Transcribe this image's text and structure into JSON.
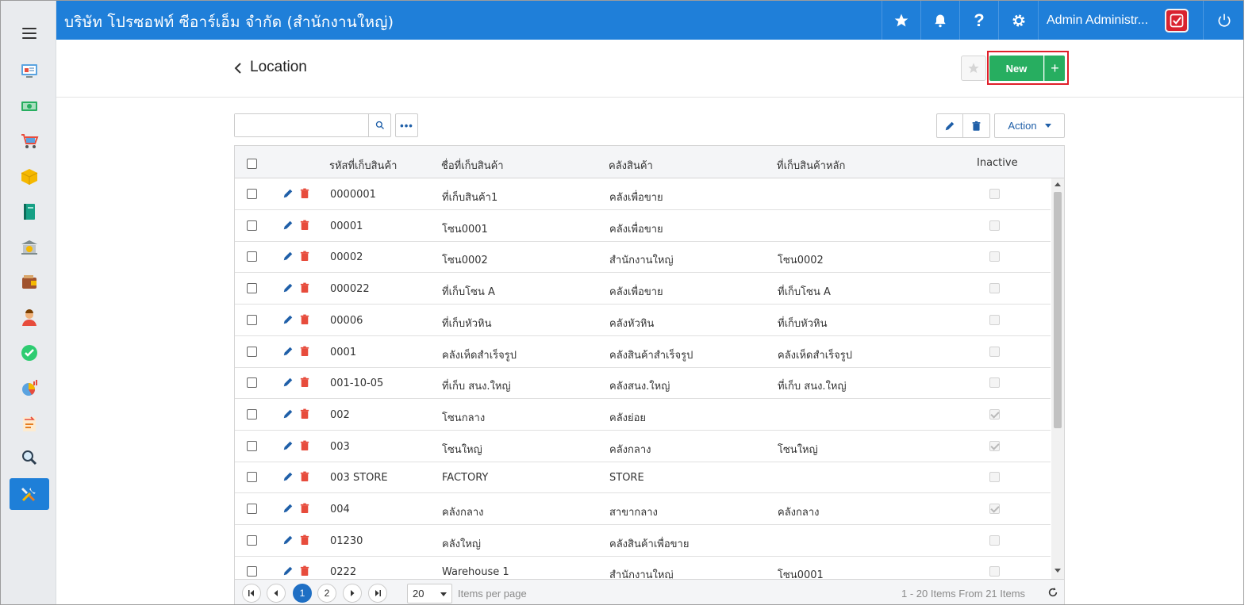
{
  "colors": {
    "topbar": "#1f7fd9",
    "new_button": "#27ae60",
    "highlight": "#e0202a",
    "link_blue": "#1f5fa8",
    "delete_red": "#e74c3c",
    "pager_active": "#1f6fc4"
  },
  "topbar": {
    "company": "บริษัท โปรซอฟท์ ซีอาร์เอ็ม จำกัด (สำนักงานใหญ่)",
    "user_name": "Admin Administr...",
    "icons": [
      "star-icon",
      "bell-icon",
      "help-icon",
      "gear-icon",
      "avatar",
      "power-icon"
    ]
  },
  "sidebar": {
    "icons": [
      "menu-icon",
      "dashboard-icon",
      "money-icon",
      "cart-icon",
      "box-icon",
      "book-icon",
      "bank-icon",
      "wallet-icon",
      "user-icon",
      "check-icon",
      "pie-chart-icon",
      "transfer-icon",
      "search-icon",
      "tools-icon"
    ],
    "active": "tools-icon"
  },
  "header": {
    "title": "Location",
    "new_label": "New",
    "new_plus": "+"
  },
  "toolbar": {
    "search_placeholder": "",
    "more": "•••",
    "action_label": "Action"
  },
  "table": {
    "columns": [
      "รหัสที่เก็บสินค้า",
      "ชื่อที่เก็บสินค้า",
      "คลังสินค้า",
      "ที่เก็บสินค้าหลัก",
      "Inactive"
    ],
    "rows": [
      {
        "code": "0000001",
        "name": "ที่เก็บสินค้า1",
        "warehouse": "คลังเพื่อขาย",
        "parent": "",
        "inactive": false
      },
      {
        "code": "00001",
        "name": "โซน0001",
        "warehouse": "คลังเพื่อขาย",
        "parent": "",
        "inactive": false
      },
      {
        "code": "00002",
        "name": "โซน0002",
        "warehouse": "สำนักงานใหญ่",
        "parent": "โซน0002",
        "inactive": false
      },
      {
        "code": "000022",
        "name": "ที่เก็บโซน A",
        "warehouse": "คลังเพื่อขาย",
        "parent": "ที่เก็บโซน A",
        "inactive": false
      },
      {
        "code": "00006",
        "name": "ที่เก็บหัวหิน",
        "warehouse": "คลังหัวหิน",
        "parent": "ที่เก็บหัวหิน",
        "inactive": false
      },
      {
        "code": "0001",
        "name": "คลังเห็ดสำเร็จรูป",
        "warehouse": "คลังสินค้าสำเร็จรูป",
        "parent": "คลังเห็ดสำเร็จรูป",
        "inactive": false
      },
      {
        "code": "001-10-05",
        "name": "ที่เก็บ สนง.ใหญ่",
        "warehouse": "คลังสนง.ใหญ่",
        "parent": "ที่เก็บ สนง.ใหญ่",
        "inactive": false
      },
      {
        "code": "002",
        "name": "โซนกลาง",
        "warehouse": "คลังย่อย",
        "parent": "",
        "inactive": true
      },
      {
        "code": "003",
        "name": "โซนใหญ่",
        "warehouse": "คลังกลาง",
        "parent": "โซนใหญ่",
        "inactive": true
      },
      {
        "code": "003 STORE",
        "name": "FACTORY",
        "warehouse": "STORE",
        "parent": "",
        "inactive": false
      },
      {
        "code": "004",
        "name": "คลังกลาง",
        "warehouse": "สาขากลาง",
        "parent": "คลังกลาง",
        "inactive": true
      },
      {
        "code": "01230",
        "name": "คลังใหญ่",
        "warehouse": "คลังสินค้าเพื่อขาย",
        "parent": "",
        "inactive": false
      },
      {
        "code": "0222",
        "name": "Warehouse 1",
        "warehouse": "สำนักงานใหญ่",
        "parent": "โซน0001",
        "inactive": false
      }
    ]
  },
  "pager": {
    "pages": [
      "1",
      "2"
    ],
    "current": "1",
    "page_size": "20",
    "items_per_page": "Items per page",
    "info": "1 - 20 Items From 21 Items"
  }
}
